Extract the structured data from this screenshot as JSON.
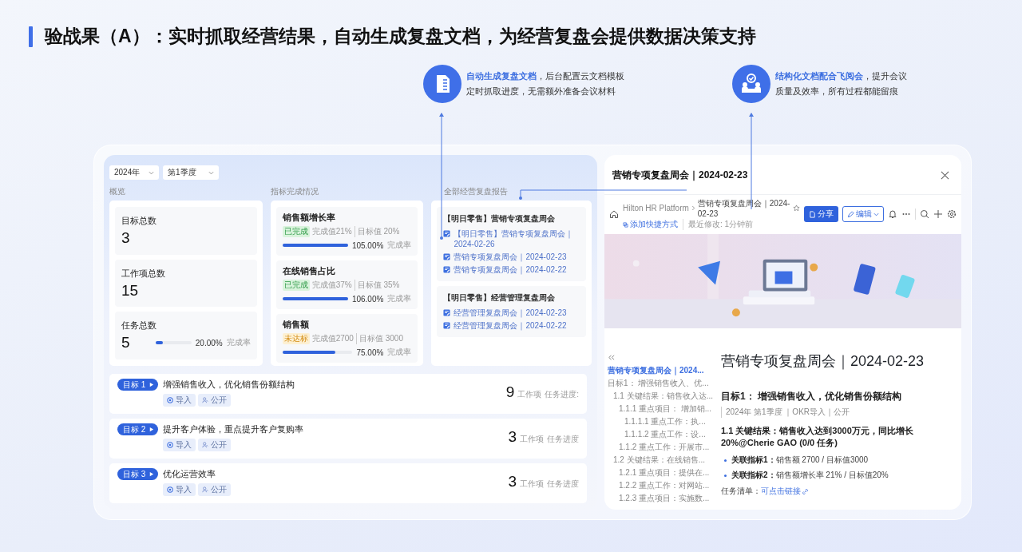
{
  "slide_title": "验战果（A）：实时抓取经营结果，自动生成复盘文档，为经营复盘会提供数据决策支持",
  "callouts": [
    {
      "kind": "document",
      "lines": [
        "**自动生成复盘文档**，后台配置云文档模板",
        "定时抓取进度，无需额外准备会议材料"
      ]
    },
    {
      "kind": "meeting",
      "lines": [
        "**结构化文档配合飞阅会**，提升会议",
        "质量及效率，所有过程都能留痕"
      ]
    }
  ],
  "dashboard": {
    "filters": [
      "2024年",
      "第1季度"
    ],
    "overview": {
      "heading": "概览",
      "stats": [
        {
          "label": "目标总数",
          "value": "3"
        },
        {
          "label": "工作项总数",
          "value": "15"
        },
        {
          "label": "任务总数",
          "value": "5",
          "level": 0.2,
          "percent": "20.00%",
          "rate_label": "完成率"
        }
      ]
    },
    "indicators": {
      "heading": "指标完成情况",
      "items": [
        {
          "name": "销售额增长率",
          "status": {
            "kind": "done",
            "text": "已完成"
          },
          "actual": "完成值21%",
          "target": "目标值 20%",
          "level": 1,
          "percent": "105.00%",
          "rate_label": "完成率"
        },
        {
          "name": "在线销售占比",
          "status": {
            "kind": "done",
            "text": "已完成"
          },
          "actual": "完成值37%",
          "target": "目标值 35%",
          "level": 1,
          "percent": "106.00%",
          "rate_label": "完成率"
        },
        {
          "name": "销售额",
          "status": {
            "kind": "pending",
            "text": "未达标"
          },
          "actual": "完成值2700",
          "target": "目标值 3000",
          "level": 0.75,
          "percent": "75.00%",
          "rate_label": "完成率"
        }
      ]
    },
    "reports": {
      "heading": "全部经营复盘报告",
      "groups": [
        {
          "title": "【明日零售】营销专项复盘周会",
          "links": [
            "【明日零售】营销专项复盘周会｜2024-02-26",
            "营销专项复盘周会｜2024-02-23",
            "营销专项复盘周会｜2024-02-22"
          ]
        },
        {
          "title": "【明日零售】经营管理复盘周会",
          "links": [
            "经营管理复盘周会｜2024-02-23",
            "经营管理复盘周会｜2024-02-22"
          ]
        }
      ]
    },
    "goals": [
      {
        "tag": "目标 1",
        "title": "增强销售收入，优化销售份额结构",
        "chips": [
          {
            "kind": "import",
            "text": "导入"
          },
          {
            "kind": "public",
            "text": "公开"
          }
        ],
        "count": "9",
        "unit": "工作项",
        "progress_label": "任务进度:"
      },
      {
        "tag": "目标 2",
        "title": "提升客户体验，重点提升客户复购率",
        "chips": [
          {
            "kind": "import",
            "text": "导入"
          },
          {
            "kind": "public",
            "text": "公开"
          }
        ],
        "count": "3",
        "unit": "工作项",
        "progress_label": "任务进度"
      },
      {
        "tag": "目标 3",
        "title": "优化运营效率",
        "chips": [
          {
            "kind": "import",
            "text": "导入"
          },
          {
            "kind": "public",
            "text": "公开"
          }
        ],
        "count": "3",
        "unit": "工作项",
        "progress_label": "任务进度"
      }
    ]
  },
  "doc_panel": {
    "title": "营销专项复盘周会｜2024-02-23",
    "breadcrumb": [
      "Hilton HR Platform",
      "营销专项复盘周会｜2024-02-23"
    ],
    "shortcut": "添加快捷方式",
    "modified": "最近修改: 1分钟前",
    "share_button": "分享",
    "edit_button": "编辑",
    "toc": [
      {
        "text": "营销专项复盘周会｜2024...",
        "selected": true
      },
      {
        "text": "目标1：  增强销售收入、优...",
        "selected": false,
        "children": [
          {
            "text": "1.1 关键结果：销售收入达...",
            "selected": false,
            "children": [
              {
                "text": "1.1.1 重点项目：  增加销...",
                "selected": false,
                "children": [
                  {
                    "text": "1.1.1.1 重点工作：执...",
                    "selected": false
                  },
                  {
                    "text": "1.1.1.2 重点工作：设...",
                    "selected": false
                  }
                ]
              },
              {
                "text": "1.1.2 重点工作：开展市...",
                "selected": false
              }
            ]
          },
          {
            "text": "1.2 关键结果：在线销售...",
            "selected": false,
            "children": [
              {
                "text": "1.2.1 重点项目：提供在...",
                "selected": false
              },
              {
                "text": "1.2.2 重点工作：对网站...",
                "selected": false
              },
              {
                "text": "1.2.3 重点项目：实施数...",
                "selected": false
              }
            ]
          }
        ]
      }
    ],
    "heading": "营销专项复盘周会｜2024-02-23",
    "goal_heading": "目标1：  增强销售收入，优化销售份额结构",
    "meta": "2024年 第1季度 ｜OKR导入｜公开",
    "key_result": "1.1 关键结果：销售收入达到3000万元，同比增长20%@Cherie GAO (0/0 任务)",
    "bullets": [
      "**关联指标1：**销售额 2700 / 目标值3000",
      "**关联指标2：**销售额增长率 21% / 目标值20%"
    ],
    "task_label": "任务清单：",
    "task_link": "可点击链接"
  }
}
